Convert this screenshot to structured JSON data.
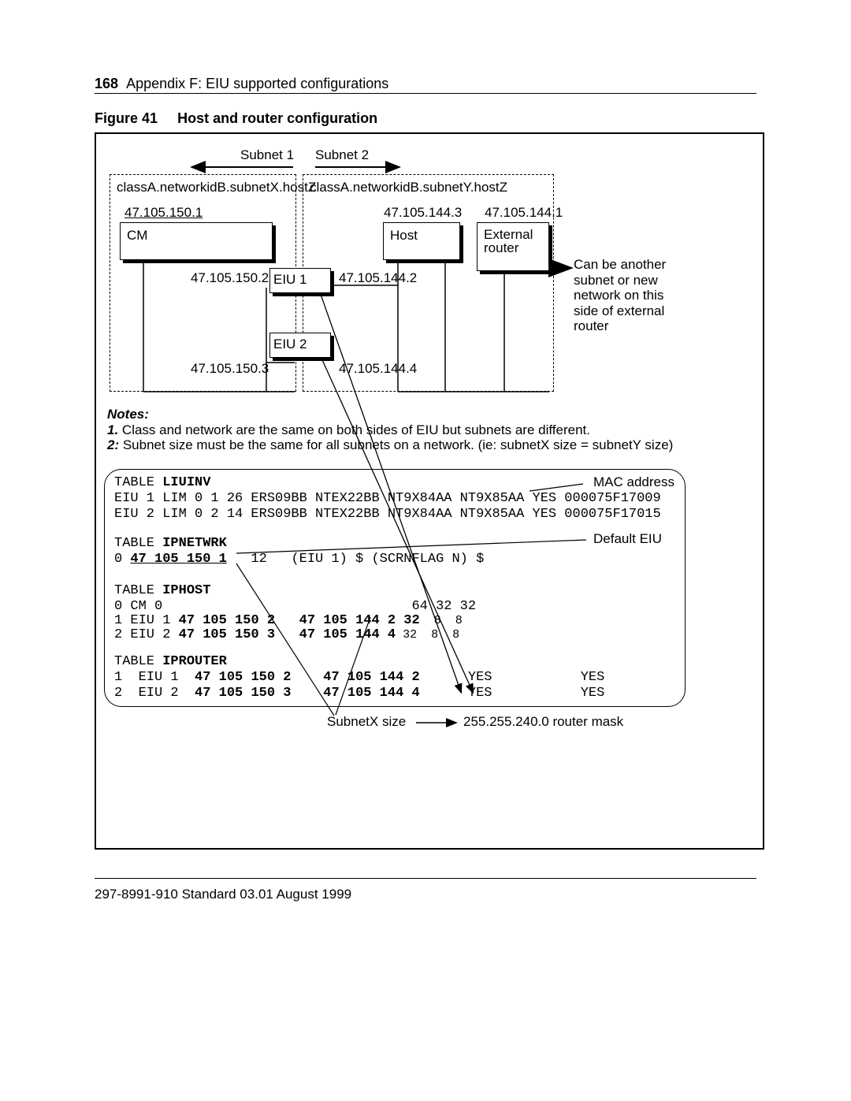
{
  "header": {
    "page_number": "168",
    "appendix_text": "Appendix F: EIU supported configurations"
  },
  "figure": {
    "label": "Figure 41",
    "title": "Host and router configuration"
  },
  "diagram": {
    "subnet1": "Subnet 1",
    "subnet2": "Subnet 2",
    "classA_left": "classA.networkidB.subnetX.hostZ",
    "classA_right": "classA.networkidB.subnetY.hostZ",
    "cm_ip": "47.105.150.1",
    "cm_label": "CM",
    "host_ip": "47.105.144.3",
    "host_label": "Host",
    "ext_router_ip": "47.105.144.1",
    "ext_router_label1": "External",
    "ext_router_label2": "router",
    "eiu1_left_ip": "47.105.150.2",
    "eiu1_right_ip": "47.105.144.2",
    "eiu1_label": "EIU 1",
    "eiu2_left_ip": "47.105.150.3",
    "eiu2_right_ip": "47.105.144.4",
    "eiu2_label": "EIU 2",
    "side_note_l1": "Can be another",
    "side_note_l2": "subnet or new",
    "side_note_l3": "network on this",
    "side_note_l4": "side of external",
    "side_note_l5": "router"
  },
  "notes": {
    "heading": "Notes:",
    "n1_lead": "1.",
    "n1_text": " Class and network are the same on both sides of EIU but subnets are different.",
    "n2_lead": "2:",
    "n2_text": " Subnet size must be the same for all subnets on a network. (ie: subnetX size = subnetY size)"
  },
  "tables": {
    "liuinv": {
      "title_pre": "TABLE ",
      "title": "LIUINV",
      "row1": "EIU 1 LIM 0 1 26 ERS09BB NTEX22BB NT9X84AA NT9X85AA YES 000075F17009",
      "row2": "EIU 2 LIM 0 2 14 ERS09BB NTEX22BB NT9X84AA NT9X85AA YES 000075F17015"
    },
    "ipnetwrk": {
      "title_pre": "TABLE ",
      "title": "IPNETWRK",
      "row_pre": "0 ",
      "row_ul": "47 105 150 1",
      "row_post": "   12   (EIU 1) $ (SCRNFLAG N) $"
    },
    "iphost": {
      "title_pre": "TABLE ",
      "title": "IPHOST",
      "row0": "0 CM 0                               64 32 32",
      "row1_plain": "1 EIU 1 ",
      "row1_b1": "47 105 150 2",
      "row1_sep": "   ",
      "row1_b2": "47 105 144 2 32",
      "row1_tail": "  8  8",
      "row2_plain": "2 EIU 2 ",
      "row2_b1": "47 105 150 3",
      "row2_sep": "   ",
      "row2_b2": "47 105 144 4",
      "row2_tail": " 32  8  8"
    },
    "iprouter": {
      "title_pre": "TABLE ",
      "title": "IPROUTER",
      "r1_a": "1  EIU 1  ",
      "r1_b1": "47 105 150 2",
      "r1_sep": "    ",
      "r1_b2": "47 105 144 2",
      "r1_tail": "      YES           YES",
      "r2_a": "2  EIU 2  ",
      "r2_b1": "47 105 150 3",
      "r2_sep": "    ",
      "r2_b2": "47 105 144 4",
      "r2_tail": "      YES           YES"
    }
  },
  "callouts": {
    "mac_address": "MAC address",
    "default_eiu": "Default EIU",
    "subnetx_size": "SubnetX size",
    "router_mask": "255.255.240.0 router mask"
  },
  "footer": {
    "text": "297-8991-910  Standard  03.01  August 1999"
  }
}
